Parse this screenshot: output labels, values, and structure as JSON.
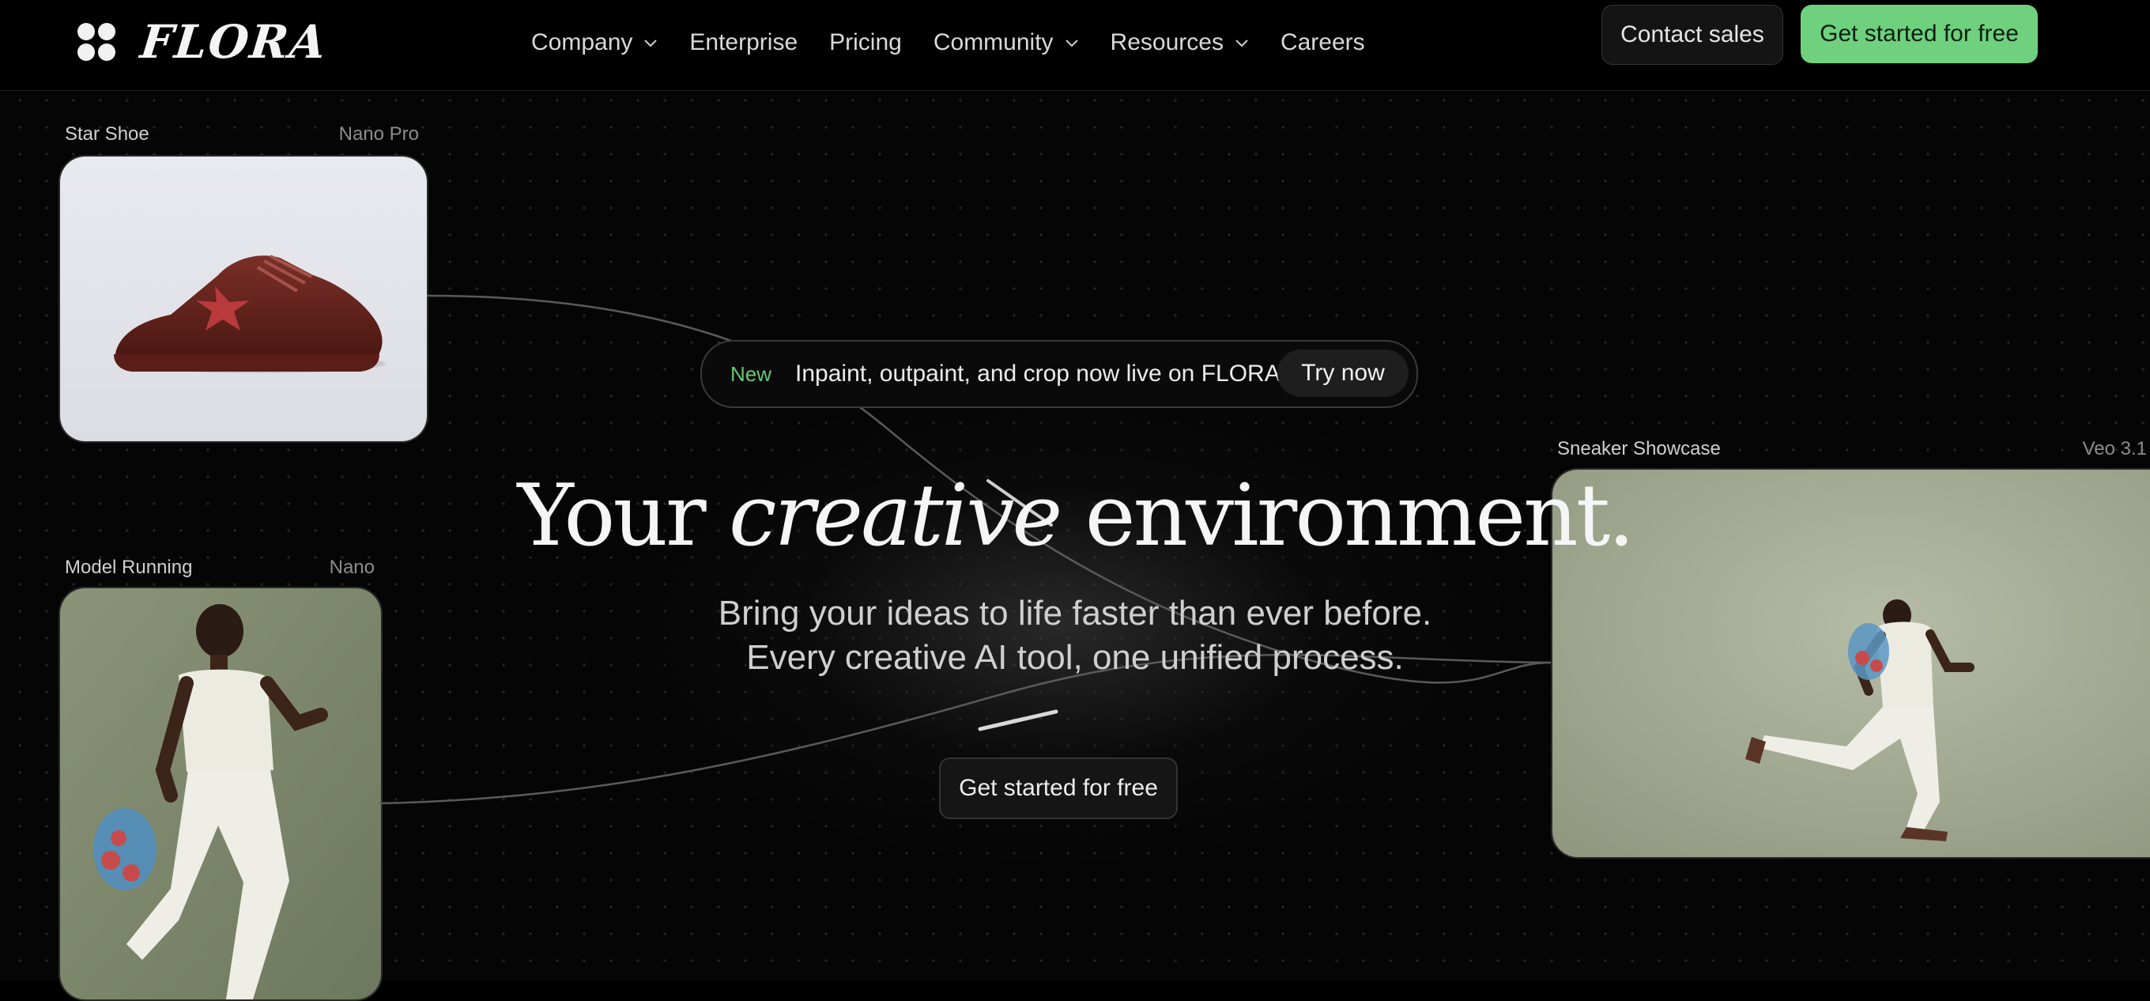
{
  "brand": {
    "name": "FLORA",
    "logo_icon": "flora-flower-icon"
  },
  "nav": {
    "links": [
      {
        "label": "Company",
        "has_dropdown": true
      },
      {
        "label": "Enterprise",
        "has_dropdown": false
      },
      {
        "label": "Pricing",
        "has_dropdown": false
      },
      {
        "label": "Community",
        "has_dropdown": true
      },
      {
        "label": "Resources",
        "has_dropdown": true
      },
      {
        "label": "Careers",
        "has_dropdown": false
      }
    ],
    "contact_label": "Contact sales",
    "cta_label": "Get started for free"
  },
  "announcement": {
    "badge": "New",
    "text": "Inpaint, outpaint, and crop now live on FLORA",
    "button": "Try now"
  },
  "hero": {
    "headline_pre": "Your",
    "headline_em": "creative",
    "headline_post": "environment.",
    "sub_line1": "Bring your ideas to life faster than ever before.",
    "sub_line2": "Every creative AI tool, one unified process.",
    "cta_label": "Get started for free"
  },
  "cards": [
    {
      "title": "Star Shoe",
      "model": "Nano Pro"
    },
    {
      "title": "Model Running",
      "model": "Nano"
    },
    {
      "title": "Sneaker Showcase",
      "model": "Veo 3.1"
    }
  ],
  "colors": {
    "accent_green": "#6fd07e",
    "background": "#000000"
  }
}
